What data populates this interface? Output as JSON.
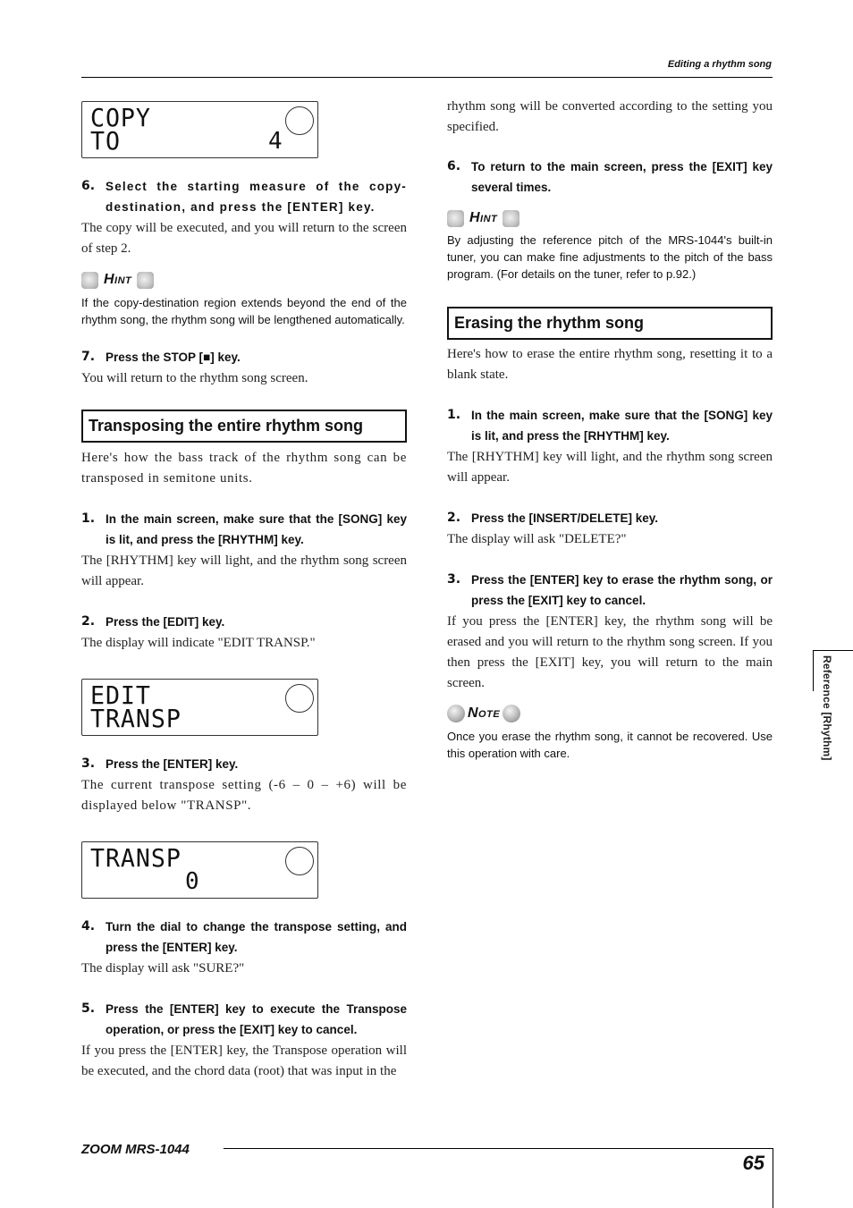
{
  "header": {
    "title": "Editing a rhythm song"
  },
  "left_column": {
    "lcd_copy": {
      "line1": "COPY",
      "line2": "TO",
      "value": "4"
    },
    "step6": {
      "number": "6.",
      "text": "Select the starting measure of the copy-destination, and press the [ENTER] key."
    },
    "step6_body": "The copy will be executed, and you will return to the screen of step 2.",
    "hint1": {
      "label": "Hint",
      "text": "If the copy-destination region extends beyond the end of the rhythm song, the rhythm song will be lengthened automatically."
    },
    "step7": {
      "number": "7.",
      "text": "Press the STOP [■] key."
    },
    "step7_body": "You will return to the rhythm song screen.",
    "section_transpose": {
      "title": "Transposing the entire rhythm song",
      "intro": "Here's how the bass track of the rhythm song can be transposed in semitone units.",
      "step1": {
        "number": "1.",
        "text": "In the main screen, make sure that the [SONG] key is lit, and press the [RHYTHM] key."
      },
      "step1_body": "The [RHYTHM] key will light, and the rhythm song screen will appear.",
      "step2": {
        "number": "2.",
        "text": "Press the [EDIT] key."
      },
      "step2_body": "The display will indicate \"EDIT TRANSP.\"",
      "lcd_edit": {
        "line1": "EDIT",
        "line2": "TRANSP"
      },
      "step3": {
        "number": "3.",
        "text": "Press the [ENTER] key."
      },
      "step3_body": "The current transpose setting (-6 – 0 – +6) will be displayed below \"TRANSP\".",
      "lcd_transp": {
        "line1": "TRANSP",
        "value": "0"
      },
      "step4": {
        "number": "4.",
        "text": "Turn the dial to change the transpose setting, and press the [ENTER] key."
      },
      "step4_body": "The display will ask \"SURE?\"",
      "step5": {
        "number": "5.",
        "text": "Press the [ENTER] key to execute the Transpose operation, or press the [EXIT] key to cancel."
      },
      "step5_body": "If you press the [ENTER] key, the Transpose operation will be executed, and the chord data (root) that was input in the"
    }
  },
  "right_column": {
    "continued_body": "rhythm song will be converted according to the setting you specified.",
    "step6": {
      "number": "6.",
      "text": "To return to the main screen, press the [EXIT] key several times."
    },
    "hint2": {
      "label": "Hint",
      "text": "By adjusting the reference pitch of the MRS-1044's built-in tuner, you can make fine adjustments to the pitch of the bass program. (For details on the tuner, refer to p.92.)"
    },
    "section_erase": {
      "title": "Erasing the rhythm song",
      "intro": "Here's how to erase the entire rhythm song, resetting it to a blank state.",
      "step1": {
        "number": "1.",
        "text": "In the main screen, make sure that the [SONG] key is lit, and press the [RHYTHM] key."
      },
      "step1_body": "The [RHYTHM] key will light, and the rhythm song screen will appear.",
      "step2": {
        "number": "2.",
        "text": "Press the [INSERT/DELETE] key."
      },
      "step2_body": "The display will ask \"DELETE?\"",
      "step3": {
        "number": "3.",
        "text": "Press the [ENTER] key to erase the rhythm song, or press the [EXIT] key to cancel."
      },
      "step3_body": "If you press the [ENTER] key, the rhythm song will be erased and you will return to the rhythm song screen. If you then press the [EXIT] key, you will return to the main screen.",
      "note": {
        "label": "Note",
        "text": "Once you erase the rhythm song, it cannot be recovered. Use this operation with care."
      }
    }
  },
  "side_tab": {
    "text": "Reference [Rhythm]"
  },
  "footer": {
    "brand": "ZOOM MRS-1044",
    "page_number": "65"
  }
}
